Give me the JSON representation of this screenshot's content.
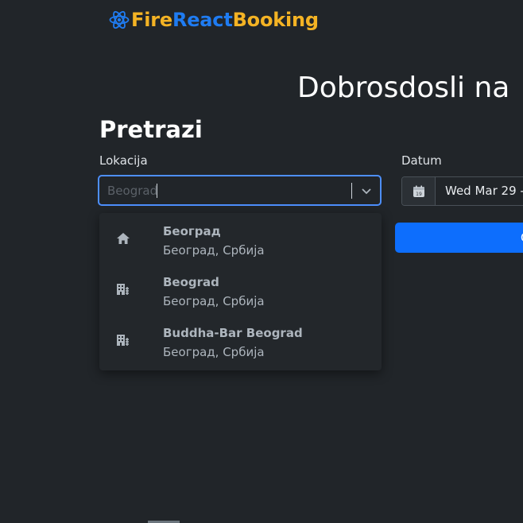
{
  "brand": {
    "icon": "atom-icon",
    "part1": "Fire",
    "part2": "React",
    "part3": "Booking",
    "colors": {
      "fire": "#f4b324",
      "react": "#1f7cf2",
      "booking": "#f4b324"
    }
  },
  "hero": {
    "welcome": "Dobrosdosli na"
  },
  "search": {
    "title": "Pretrazi",
    "location_label": "Lokacija",
    "location_value": "Beograd",
    "date_label": "Datum",
    "date_icon": "calendar-icon",
    "date_value": "Wed Mar 29 -",
    "button_label": "C"
  },
  "dropdown": {
    "options": [
      {
        "icon": "home-icon",
        "name": "Београд",
        "sub": "Београд, Србија"
      },
      {
        "icon": "building-icon",
        "name": "Beograd",
        "sub": "Београд, Србија"
      },
      {
        "icon": "building-icon",
        "name": "Buddha-Bar Beograd",
        "sub": "Београд, Србија"
      }
    ]
  },
  "colors": {
    "background": "#212529",
    "accent": "#0d6efd",
    "focus_border": "#4d8ffd"
  }
}
